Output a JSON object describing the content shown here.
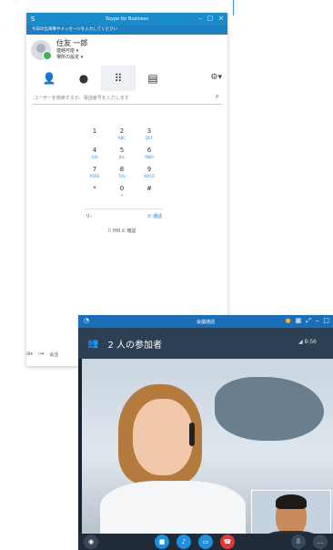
{
  "sfb": {
    "title": "Skype for Business",
    "status_message": "今日の出来事やメッセージを入力してください",
    "user": {
      "name": "住友 一郎",
      "presence": "連絡可能 ▾",
      "location": "場所の設定 ▾"
    },
    "search_placeholder": "ユーザーを検索するか、電話番号を入力します",
    "dialpad": [
      {
        "d": "1",
        "l": ""
      },
      {
        "d": "2",
        "l": "ABC"
      },
      {
        "d": "3",
        "l": "DEF"
      },
      {
        "d": "4",
        "l": "GHI"
      },
      {
        "d": "5",
        "l": "JKL"
      },
      {
        "d": "6",
        "l": "MNO"
      },
      {
        "d": "7",
        "l": "PQRS"
      },
      {
        "d": "8",
        "l": "TUV"
      },
      {
        "d": "9",
        "l": "WXYZ"
      },
      {
        "d": "*",
        "l": ""
      },
      {
        "d": "0",
        "l": "+"
      },
      {
        "d": "#",
        "l": ""
      }
    ],
    "back_label": "リ-",
    "call_label": "通話",
    "pin_label": "PIN",
    "confirm_label": "確認",
    "footer": "会話"
  },
  "video": {
    "title": "会議通話",
    "participants_label": "2 人の参加者",
    "time": "8:56"
  },
  "colors": {
    "accent": "#1a8ccc",
    "end_call": "#e23838"
  }
}
